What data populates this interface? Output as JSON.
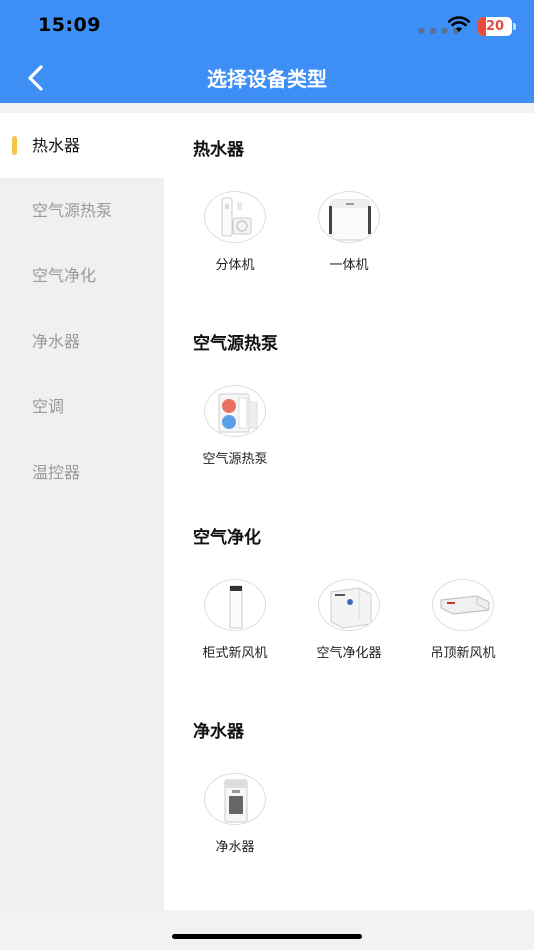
{
  "status_bar": {
    "time": "15:09",
    "battery": "20"
  },
  "nav": {
    "title": "选择设备类型",
    "back_icon": "chevron-left-icon"
  },
  "sidebar": {
    "items": [
      {
        "label": "热水器",
        "active": true
      },
      {
        "label": "空气源热泵",
        "active": false
      },
      {
        "label": "空气净化",
        "active": false
      },
      {
        "label": "净水器",
        "active": false
      },
      {
        "label": "空调",
        "active": false
      },
      {
        "label": "温控器",
        "active": false
      }
    ]
  },
  "sections": [
    {
      "title": "热水器",
      "devices": [
        {
          "label": "分体机",
          "icon": "split-water-heater-icon"
        },
        {
          "label": "一体机",
          "icon": "integrated-water-heater-icon"
        }
      ]
    },
    {
      "title": "空气源热泵",
      "devices": [
        {
          "label": "空气源热泵",
          "icon": "heat-pump-icon"
        }
      ]
    },
    {
      "title": "空气净化",
      "devices": [
        {
          "label": "柜式新风机",
          "icon": "cabinet-fresh-air-icon"
        },
        {
          "label": "空气净化器",
          "icon": "air-purifier-icon"
        },
        {
          "label": "吊顶新风机",
          "icon": "ceiling-fresh-air-icon"
        }
      ]
    },
    {
      "title": "净水器",
      "devices": [
        {
          "label": "净水器",
          "icon": "water-purifier-icon"
        }
      ]
    }
  ],
  "colors": {
    "primary": "#3d8ef5",
    "indicator": "#f3c64a",
    "sidebar_bg": "#f0f0f0",
    "battery_low": "#e84a3c"
  }
}
